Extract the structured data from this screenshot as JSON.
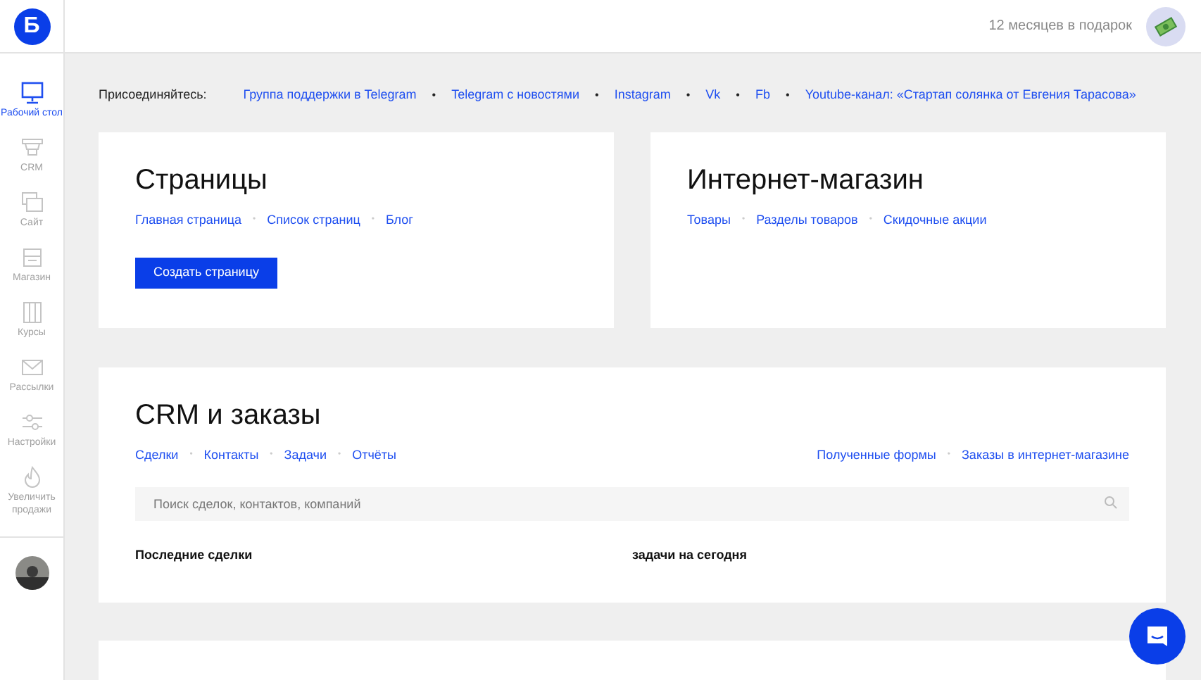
{
  "logo": "Б",
  "sidebar": {
    "items": [
      {
        "label": "Рабочий стол",
        "selected": true
      },
      {
        "label": "CRM",
        "selected": false
      },
      {
        "label": "Сайт",
        "selected": false
      },
      {
        "label": "Магазин",
        "selected": false
      },
      {
        "label": "Курсы",
        "selected": false
      },
      {
        "label": "Рассылки",
        "selected": false
      },
      {
        "label": "Настройки",
        "selected": false
      },
      {
        "label": "Увеличить продажи",
        "selected": false
      }
    ]
  },
  "header": {
    "promo": "12 месяцев в подарок"
  },
  "join_bar": {
    "label": "Присоединяйтесь:",
    "separator": "•",
    "links": [
      "Группа поддержки в Telegram",
      "Telegram с новостями",
      "Instagram",
      "Vk",
      "Fb",
      "Youtube-канал: «Стартап солянка от Евгения Тарасова»"
    ]
  },
  "cards": [
    {
      "title": "Страницы",
      "links": [
        "Главная страница",
        "Список страниц",
        "Блог"
      ],
      "button": "Создать страницу"
    },
    {
      "title": "Интернет-магазин",
      "links": [
        "Товары",
        "Разделы товаров",
        "Скидочные акции"
      ]
    }
  ],
  "crm": {
    "title": "CRM и заказы",
    "links": [
      "Сделки",
      "Контакты",
      "Задачи",
      "Отчёты"
    ],
    "right_links": [
      "Полученные формы",
      "Заказы в интернет-магазине"
    ],
    "search": {
      "placeholder": "Поиск сделок, контактов, компаний"
    },
    "columns": [
      "Последние сделки",
      "задачи на сегодня"
    ]
  }
}
